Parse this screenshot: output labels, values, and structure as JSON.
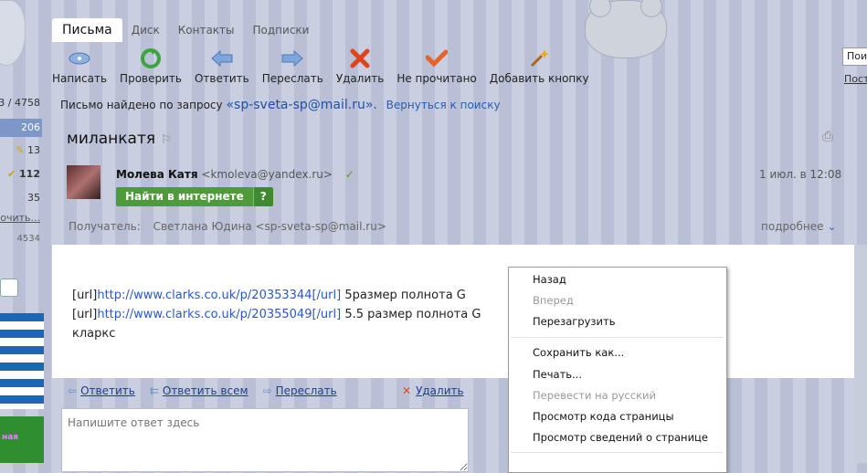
{
  "left_sidebar": {
    "count_total": "3 / 4758",
    "count_inbox": "206",
    "count_a": "13",
    "count_b": "112",
    "count_c": "35",
    "link_partial": "рочить...",
    "num_partial": "4534",
    "promo_partial": "ная"
  },
  "tabs": [
    {
      "label": "Письма"
    },
    {
      "label": "Диск"
    },
    {
      "label": "Контакты"
    },
    {
      "label": "Подписки"
    }
  ],
  "top_right": {
    "search_partial": "Пои",
    "link_partial": "Пост"
  },
  "toolbar": {
    "write": "Написать",
    "check": "Проверить",
    "reply": "Ответить",
    "forward": "Переслать",
    "delete": "Удалить",
    "unread": "Не прочитано",
    "add_button": "Добавить кнопку"
  },
  "search_result": {
    "prefix": "Письмо найдено по запросу",
    "query": "«sp-sveta-sp@mail.ru».",
    "back_link": "Вернуться к поиску"
  },
  "message": {
    "subject": "миланкатя",
    "sender_name": "Молева Катя",
    "sender_email": "<kmoleva@yandex.ru>",
    "date": "1 июл. в 12:08",
    "find_button": "Найти в интернете",
    "find_question": "?",
    "recipient_label": "Получатель:",
    "recipient_value": "Светлана Юдина <sp-sveta-sp@mail.ru>",
    "more_label": "подробнее",
    "lines": [
      {
        "pre": "[url]",
        "link": "http://www.clarks.co.uk/p/20353344[/url]",
        "post": " 5размер полнота G"
      },
      {
        "pre": "[url]",
        "link": "http://www.clarks.co.uk/p/20355049[/url]",
        "post": " 5.5 размер полнота G"
      },
      {
        "pre": "кларкс",
        "link": "",
        "post": ""
      }
    ]
  },
  "actions": {
    "reply": "Ответить",
    "reply_all": "Ответить всем",
    "forward": "Переслать",
    "delete": "Удалить"
  },
  "reply_box": {
    "placeholder": "Напишите ответ здесь"
  },
  "context_menu": {
    "back": "Назад",
    "forward": "Вперед",
    "reload": "Перезагрузить",
    "save_as": "Сохранить как...",
    "print": "Печать...",
    "translate": "Перевести на русский",
    "view_source": "Просмотр кода страницы",
    "view_info": "Просмотр  сведений о странице"
  },
  "colors": {
    "accent_link": "#1e4ea6",
    "green_button": "#4f9b3c",
    "badge": "#7d97c8"
  }
}
